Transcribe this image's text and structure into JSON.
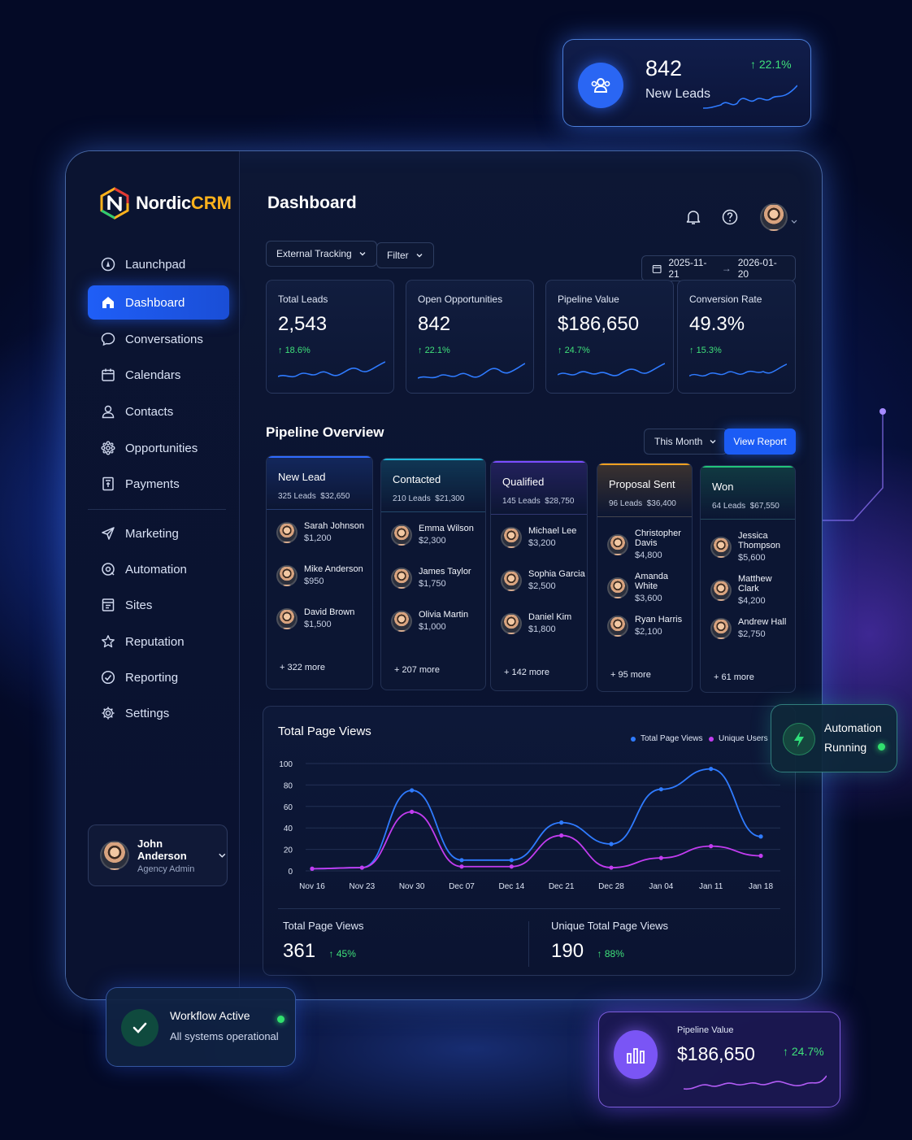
{
  "brand": {
    "part1": "Nordic",
    "part2": "CRM"
  },
  "sidebar": {
    "items": [
      {
        "label": "Launchpad",
        "icon": "launchpad-icon"
      },
      {
        "label": "Dashboard",
        "icon": "home-icon",
        "active": true
      },
      {
        "label": "Conversations",
        "icon": "chat-icon"
      },
      {
        "label": "Calendars",
        "icon": "calendar-icon"
      },
      {
        "label": "Contacts",
        "icon": "user-icon"
      },
      {
        "label": "Opportunities",
        "icon": "opportunities-icon"
      },
      {
        "label": "Payments",
        "icon": "payments-icon"
      },
      {
        "label": "Marketing",
        "icon": "send-icon"
      },
      {
        "label": "Automation",
        "icon": "automation-icon"
      },
      {
        "label": "Sites",
        "icon": "sites-icon"
      },
      {
        "label": "Reputation",
        "icon": "star-icon"
      },
      {
        "label": "Reporting",
        "icon": "reporting-icon"
      },
      {
        "label": "Settings",
        "icon": "gear-icon"
      }
    ],
    "user": {
      "name": "John Anderson",
      "role": "Agency Admin"
    }
  },
  "header": {
    "title": "Dashboard"
  },
  "toolbar": {
    "tracking": "External Tracking",
    "filter": "Filter",
    "date_from": "2025-11-21",
    "date_to": "2026-01-20"
  },
  "kpis": [
    {
      "label": "Total Leads",
      "value": "2,543",
      "change": "18.6%"
    },
    {
      "label": "Open Opportunities",
      "value": "842",
      "change": "22.1%"
    },
    {
      "label": "Pipeline Value",
      "value": "$186,650",
      "change": "24.7%"
    },
    {
      "label": "Conversion Rate",
      "value": "49.3%",
      "change": "15.3%"
    }
  ],
  "pipeline": {
    "title": "Pipeline Overview",
    "period": "This Month",
    "report_button": "View Report",
    "stages": [
      {
        "name": "New Lead",
        "leads": "325 Leads",
        "amount": "$32,650",
        "color": "#2f6bff",
        "people": [
          {
            "name": "Sarah Johnson",
            "amount": "$1,200"
          },
          {
            "name": "Mike Anderson",
            "amount": "$950"
          },
          {
            "name": "David Brown",
            "amount": "$1,500"
          }
        ],
        "more": "+ 322 more"
      },
      {
        "name": "Contacted",
        "leads": "210 Leads",
        "amount": "$21,300",
        "color": "#1fb7d8",
        "people": [
          {
            "name": "Emma Wilson",
            "amount": "$2,300"
          },
          {
            "name": "James Taylor",
            "amount": "$1,750"
          },
          {
            "name": "Olivia Martin",
            "amount": "$1,000"
          }
        ],
        "more": "+ 207 more"
      },
      {
        "name": "Qualified",
        "leads": "145 Leads",
        "amount": "$28,750",
        "color": "#7b4dff",
        "people": [
          {
            "name": "Michael Lee",
            "amount": "$3,200"
          },
          {
            "name": "Sophia Garcia",
            "amount": "$2,500"
          },
          {
            "name": "Daniel Kim",
            "amount": "$1,800"
          }
        ],
        "more": "+ 142 more"
      },
      {
        "name": "Proposal Sent",
        "leads": "96 Leads",
        "amount": "$36,400",
        "color": "#f0a020",
        "people": [
          {
            "name": "Christopher Davis",
            "amount": "$4,800"
          },
          {
            "name": "Amanda White",
            "amount": "$3,600"
          },
          {
            "name": "Ryan Harris",
            "amount": "$2,100"
          }
        ],
        "more": "+ 95 more"
      },
      {
        "name": "Won",
        "leads": "64 Leads",
        "amount": "$67,550",
        "color": "#22c47a",
        "people": [
          {
            "name": "Jessica Thompson",
            "amount": "$5,600"
          },
          {
            "name": "Matthew Clark",
            "amount": "$4,200"
          },
          {
            "name": "Andrew Hall",
            "amount": "$2,750"
          }
        ],
        "more": "+ 61 more"
      }
    ]
  },
  "page_views": {
    "title": "Total Page Views",
    "total_label": "Total Page Views",
    "total_value": "361",
    "total_change": "45%",
    "unique_label": "Unique Total Page Views",
    "unique_value": "190",
    "unique_change": "88%"
  },
  "chart_data": {
    "type": "line",
    "x": [
      "Nov 16",
      "Nov 23",
      "Nov 30",
      "Dec 07",
      "Dec 14",
      "Dec 21",
      "Dec 28",
      "Jan 04",
      "Jan 11",
      "Jan 18"
    ],
    "ylim": [
      0,
      100
    ],
    "yticks": [
      0,
      20,
      40,
      60,
      80,
      100
    ],
    "grid": true,
    "legend": "top-right",
    "series": [
      {
        "name": "Total Page Views",
        "color": "#2f7bff",
        "values": [
          2,
          3,
          75,
          10,
          10,
          45,
          25,
          76,
          95,
          32
        ]
      },
      {
        "name": "Unique Users",
        "color": "#c23cf0",
        "values": [
          2,
          3,
          55,
          4,
          4,
          33,
          3,
          12,
          23,
          14
        ]
      }
    ]
  },
  "floats": {
    "leads": {
      "value": "842",
      "label": "New Leads",
      "change": "22.1%"
    },
    "automation": {
      "line1": "Automation",
      "line2": "Running"
    },
    "workflow": {
      "title": "Workflow Active",
      "subtitle": "All systems operational"
    },
    "pipeline": {
      "label": "Pipeline Value",
      "value": "$186,650",
      "change": "24.7%"
    }
  },
  "colors": {
    "accent": "#1b5cf5",
    "positive": "#3fe07a",
    "purple": "#8a5cff"
  }
}
